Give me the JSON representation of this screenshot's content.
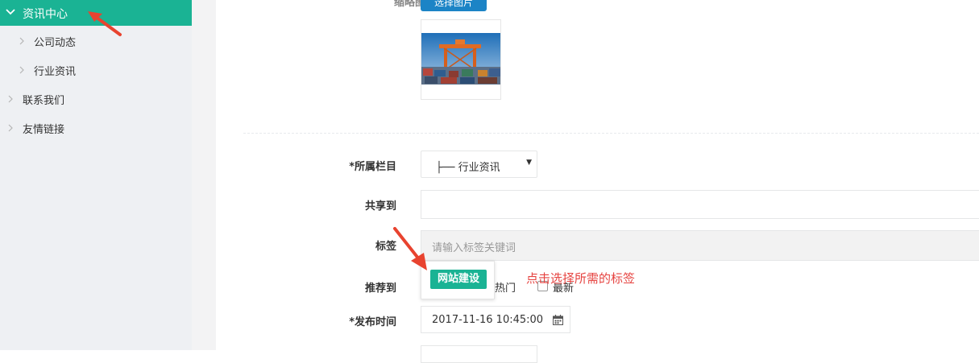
{
  "sidebar": {
    "active": "资讯中心",
    "children": [
      "公司动态",
      "行业资讯"
    ],
    "items": [
      "联系我们",
      "友情链接"
    ]
  },
  "form": {
    "thumb_label": "缩略图",
    "thumb_button": "选择图片",
    "category": {
      "label": "*所属栏目",
      "value": "├── 行业资讯"
    },
    "share": {
      "label": "共享到",
      "value": ""
    },
    "tags": {
      "label": "标签",
      "placeholder": "请输入标签关键词"
    },
    "tag_option": "网站建设",
    "hint": "点击选择所需的标签",
    "recommend": {
      "label": "推荐到",
      "options": [
        "热门",
        "最新"
      ]
    },
    "publish_time": {
      "label": "*发布时间",
      "value": "2017-11-16 10:45:00"
    }
  },
  "colors": {
    "accent": "#1ab394",
    "button_blue": "#1c84c6",
    "hint_red": "#e64340",
    "arrow_red": "#e8432f"
  },
  "icons": [
    "chevron-down-icon",
    "chevron-right-icon",
    "calendar-icon",
    "annotation-arrow-icon"
  ]
}
